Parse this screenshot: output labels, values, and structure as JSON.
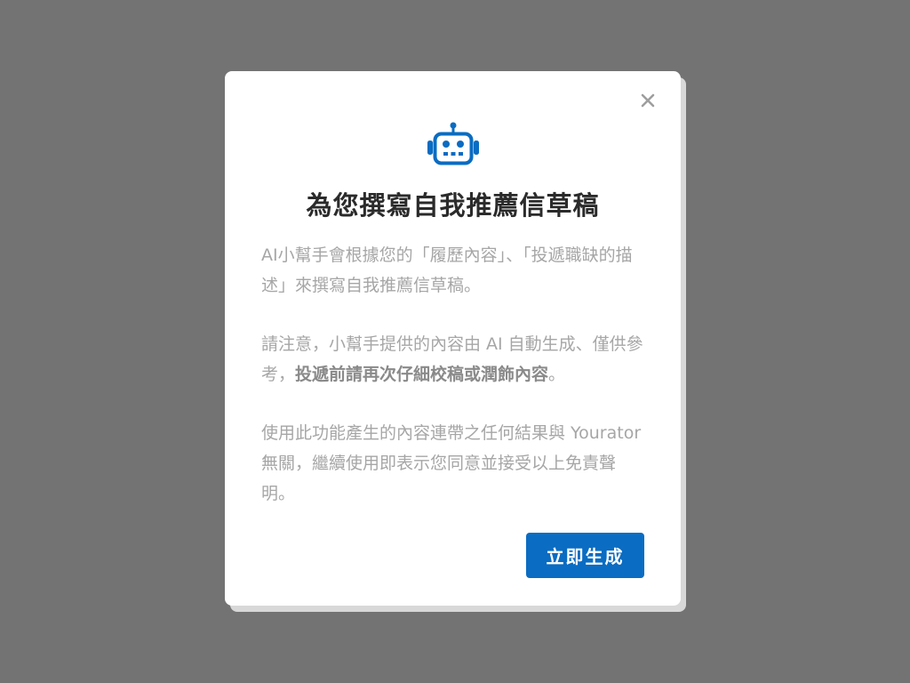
{
  "dialog": {
    "title": "為您撰寫自我推薦信草稿",
    "paragraph1": "AI小幫手會根據您的「履歷內容」、「投遞職缺的描述」來撰寫自我推薦信草稿。",
    "paragraph2_lead": "請注意，小幫手提供的內容由 AI 自動生成、僅供參考，",
    "paragraph2_bold": "投遞前請再次仔細校稿或潤飾內容",
    "paragraph2_tail": "。",
    "paragraph3": "使用此功能產生的內容連帶之任何結果與 Yourator 無關，繼續使用即表示您同意並接受以上免責聲明。",
    "cta_label": "立即生成"
  },
  "icons": {
    "header_icon": "robot-icon",
    "close_icon": "close-icon"
  },
  "colors": {
    "overlay": "#737373",
    "accent": "#0a6cc2",
    "title": "#2b2b2b",
    "body_text": "#a6a6a6"
  }
}
